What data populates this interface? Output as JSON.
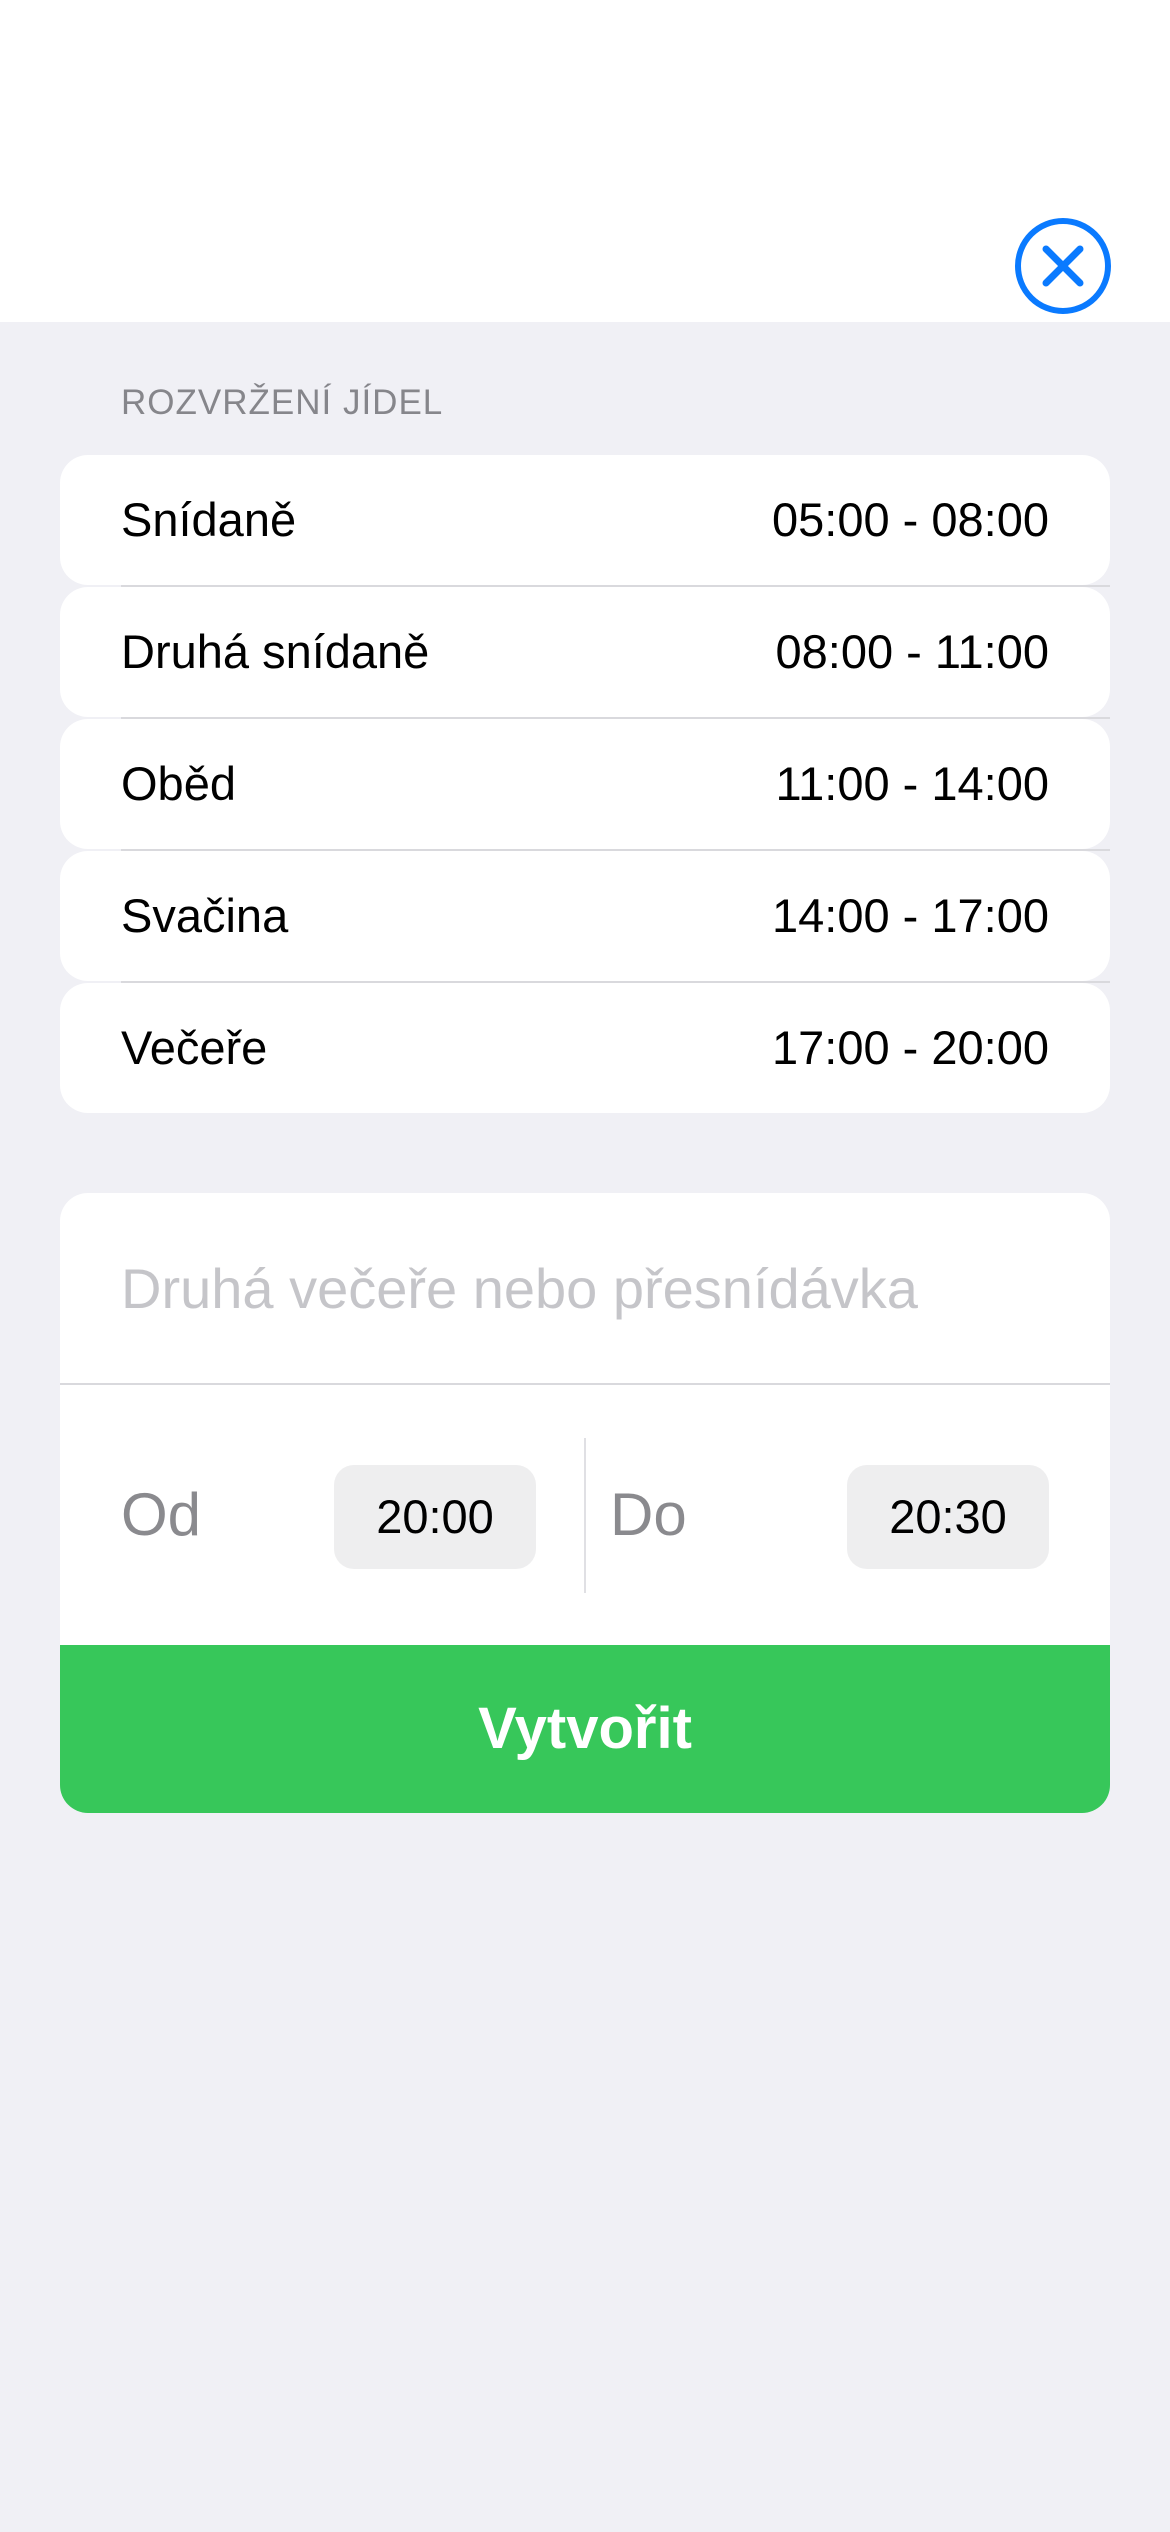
{
  "header": {
    "close_icon": "close-circle-icon",
    "accent_color": "#0a7aff"
  },
  "section": {
    "title": "ROZVRŽENÍ JÍDEL"
  },
  "meals": [
    {
      "name": "Snídaně",
      "time": "05:00 - 08:00"
    },
    {
      "name": "Druhá snídaně",
      "time": "08:00 - 11:00"
    },
    {
      "name": "Oběd",
      "time": "11:00 - 14:00"
    },
    {
      "name": "Svačina",
      "time": "14:00 - 17:00"
    },
    {
      "name": "Večeře",
      "time": "17:00 - 20:00"
    }
  ],
  "form": {
    "name_placeholder": "Druhá večeře nebo přesnídávka",
    "from_label": "Od",
    "from_value": "20:00",
    "to_label": "Do",
    "to_value": "20:30",
    "create_label": "Vytvořit",
    "create_color": "#37c75a"
  }
}
